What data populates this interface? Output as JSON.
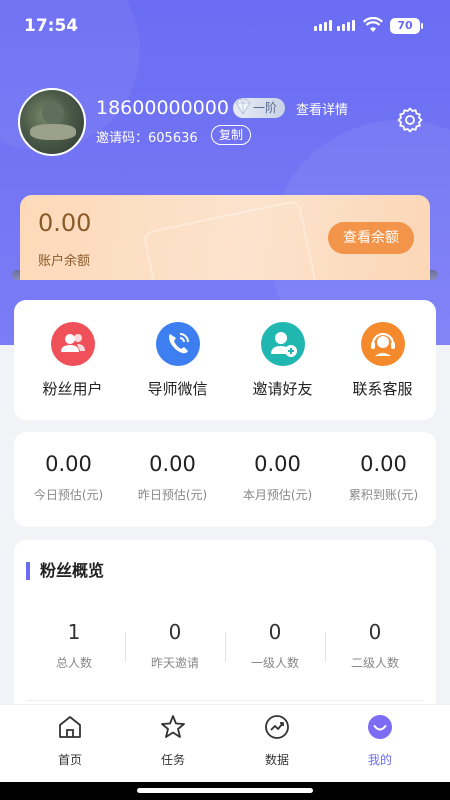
{
  "status": {
    "time": "17:54",
    "battery": "70"
  },
  "profile": {
    "phone": "18600000000",
    "level": "一阶",
    "detail_link": "查看详情",
    "invite_label": "邀请码：",
    "invite_code": "605636",
    "copy": "复制"
  },
  "balance": {
    "amount": "0.00",
    "label": "账户余额",
    "button": "查看余额"
  },
  "menu": [
    {
      "label": "粉丝用户",
      "icon": "fans-users-icon",
      "color": "#f0505a"
    },
    {
      "label": "导师微信",
      "icon": "phone-icon",
      "color": "#3d7ef0"
    },
    {
      "label": "邀请好友",
      "icon": "add-user-icon",
      "color": "#1fb7b0"
    },
    {
      "label": "联系客服",
      "icon": "customer-service-icon",
      "color": "#f58a2c"
    }
  ],
  "stats": [
    {
      "value": "0.00",
      "label": "今日预估(元)"
    },
    {
      "value": "0.00",
      "label": "昨日预估(元)"
    },
    {
      "value": "0.00",
      "label": "本月预估(元)"
    },
    {
      "value": "0.00",
      "label": "累积到账(元)"
    }
  ],
  "fans": {
    "title": "粉丝概览",
    "items": [
      {
        "value": "1",
        "label": "总人数"
      },
      {
        "value": "0",
        "label": "昨天邀请"
      },
      {
        "value": "0",
        "label": "一级人数"
      },
      {
        "value": "0",
        "label": "二级人数"
      }
    ]
  },
  "tabs": [
    {
      "label": "首页",
      "icon": "home-icon"
    },
    {
      "label": "任务",
      "icon": "star-icon"
    },
    {
      "label": "数据",
      "icon": "trend-icon"
    },
    {
      "label": "我的",
      "icon": "profile-smile-icon",
      "active": true
    }
  ],
  "colors": {
    "accent": "#6a6cf3",
    "balance_button": "#f2954a"
  }
}
